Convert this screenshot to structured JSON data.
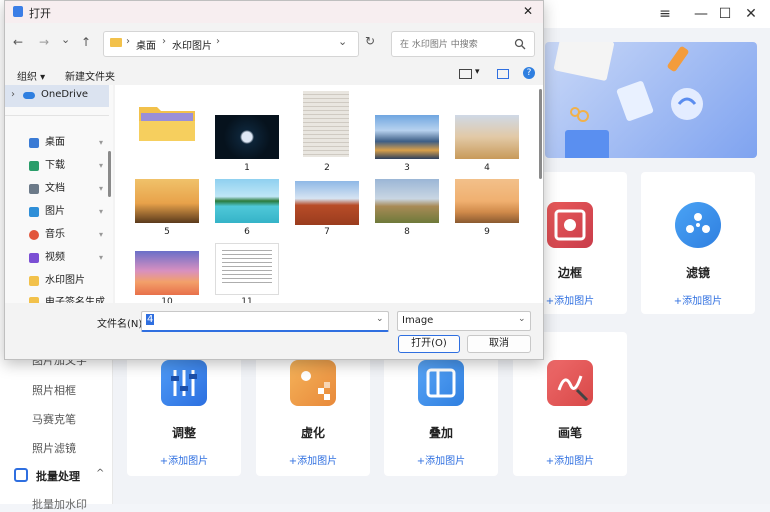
{
  "background_app": {
    "window_controls": [
      "≡",
      "—",
      "☐",
      "✕"
    ],
    "sidebar": {
      "items": [
        "图片加文字",
        "照片相框",
        "马赛克笔",
        "照片滤镜"
      ],
      "batch": {
        "label": "批量处理",
        "arrow": "^"
      },
      "partial_next": "批量加水印"
    },
    "cards_row1": [
      {
        "title": "边框",
        "add": "+添加图片",
        "icon": "frame-icon"
      },
      {
        "title": "滤镜",
        "add": "+添加图片",
        "icon": "filter-icon"
      }
    ],
    "cards_row2": [
      {
        "title": "调整",
        "add": "+添加图片",
        "icon": "sliders-icon"
      },
      {
        "title": "虚化",
        "add": "+添加图片",
        "icon": "blur-icon"
      },
      {
        "title": "叠加",
        "add": "+添加图片",
        "icon": "overlay-icon"
      },
      {
        "title": "画笔",
        "add": "+添加图片",
        "icon": "brush-icon"
      }
    ]
  },
  "dialog": {
    "title": "打开",
    "close": "✕",
    "nav": {
      "back": "←",
      "forward": "→",
      "down": "⌄",
      "up": "↑"
    },
    "address": {
      "parts": [
        "桌面",
        "水印图片"
      ],
      "sep": "›",
      "refresh": "↻",
      "dropdown": "⌄"
    },
    "search_placeholder": "在 水印图片 中搜索",
    "toolbar": {
      "organize": "组织 ▾",
      "new_folder": "新建文件夹"
    },
    "nav_pane": {
      "onedrive": "OneDrive",
      "items": [
        {
          "label": "桌面",
          "icon": "desktop-icon",
          "color": "#3a7bd5"
        },
        {
          "label": "下载",
          "icon": "download-icon",
          "color": "#2a9d6a"
        },
        {
          "label": "文档",
          "icon": "document-icon",
          "color": "#6c7a89"
        },
        {
          "label": "图片",
          "icon": "pictures-icon",
          "color": "#2f8fd8"
        },
        {
          "label": "音乐",
          "icon": "music-icon",
          "color": "#e2553b"
        },
        {
          "label": "视频",
          "icon": "video-icon",
          "color": "#7b4fd4"
        },
        {
          "label": "水印图片",
          "icon": "folder-icon",
          "color": "#f2c14b"
        },
        {
          "label": "电子签名生成",
          "icon": "folder-icon",
          "color": "#f2c14b"
        }
      ],
      "pin": "📌"
    },
    "files": [
      {
        "caption": "",
        "kind": "folder"
      },
      {
        "caption": "1",
        "kind": "image"
      },
      {
        "caption": "2",
        "kind": "image"
      },
      {
        "caption": "3",
        "kind": "image"
      },
      {
        "caption": "4",
        "kind": "image"
      },
      {
        "caption": "5",
        "kind": "image"
      },
      {
        "caption": "6",
        "kind": "image"
      },
      {
        "caption": "7",
        "kind": "image"
      },
      {
        "caption": "8",
        "kind": "image"
      },
      {
        "caption": "9",
        "kind": "image"
      },
      {
        "caption": "10",
        "kind": "image"
      },
      {
        "caption": "11",
        "kind": "image"
      }
    ],
    "filename": {
      "label": "文件名(N):",
      "value": "4"
    },
    "filetype": {
      "value": "Image"
    },
    "buttons": {
      "open": "打开(O)",
      "cancel": "取消"
    }
  }
}
